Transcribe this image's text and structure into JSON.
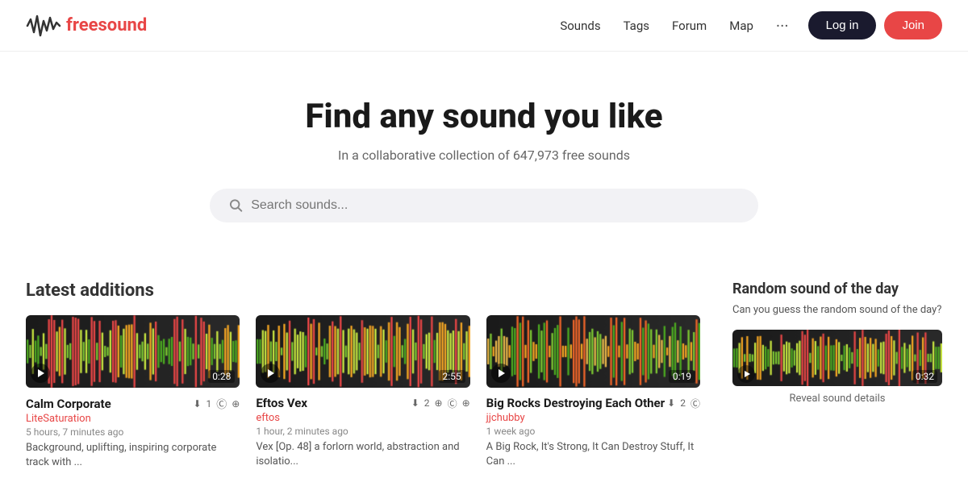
{
  "logo": {
    "text_free": "free",
    "text_sound": "sound"
  },
  "nav": {
    "sounds": "Sounds",
    "tags": "Tags",
    "forum": "Forum",
    "map": "Map",
    "dots": "···",
    "login": "Log in",
    "join": "Join"
  },
  "hero": {
    "title": "Find any sound you like",
    "subtitle": "In a collaborative collection of 647,973 free sounds",
    "search_placeholder": "Search sounds..."
  },
  "latest": {
    "section_title": "Latest additions",
    "cards": [
      {
        "name": "Calm Corporate",
        "author": "LiteSaturation",
        "time": "5 hours, 7 minutes ago",
        "description": "Background, uplifting, inspiring corporate track with ...",
        "duration": "0:28",
        "download_count": "1",
        "waveform_colors": [
          "#7dc832",
          "#4caa20",
          "#c8e640",
          "#f5a623",
          "#e84646"
        ]
      },
      {
        "name": "Eftos Vex",
        "author": "eftos",
        "time": "1 hour, 2 minutes ago",
        "description": "Vex [Op. 48] a forlorn world, abstraction and isolatio...",
        "duration": "2:55",
        "download_count": "2",
        "waveform_colors": [
          "#7dc832",
          "#4caa20",
          "#c8e640",
          "#f5a623",
          "#e84646"
        ]
      },
      {
        "name": "Big Rocks Destroying Each Other",
        "author": "jjchubby",
        "time": "1 week ago",
        "description": "A Big Rock, It's Strong, It Can Destroy Stuff, It Can ...",
        "duration": "0:19",
        "download_count": "2",
        "waveform_colors": [
          "#f5a623",
          "#7dc832",
          "#4caa20",
          "#c8e640",
          "#e84646"
        ]
      }
    ]
  },
  "random": {
    "title": "Random sound of the day",
    "subtitle": "Can you guess the random sound of the day?",
    "duration": "0:32",
    "reveal_label": "Reveal sound details"
  }
}
